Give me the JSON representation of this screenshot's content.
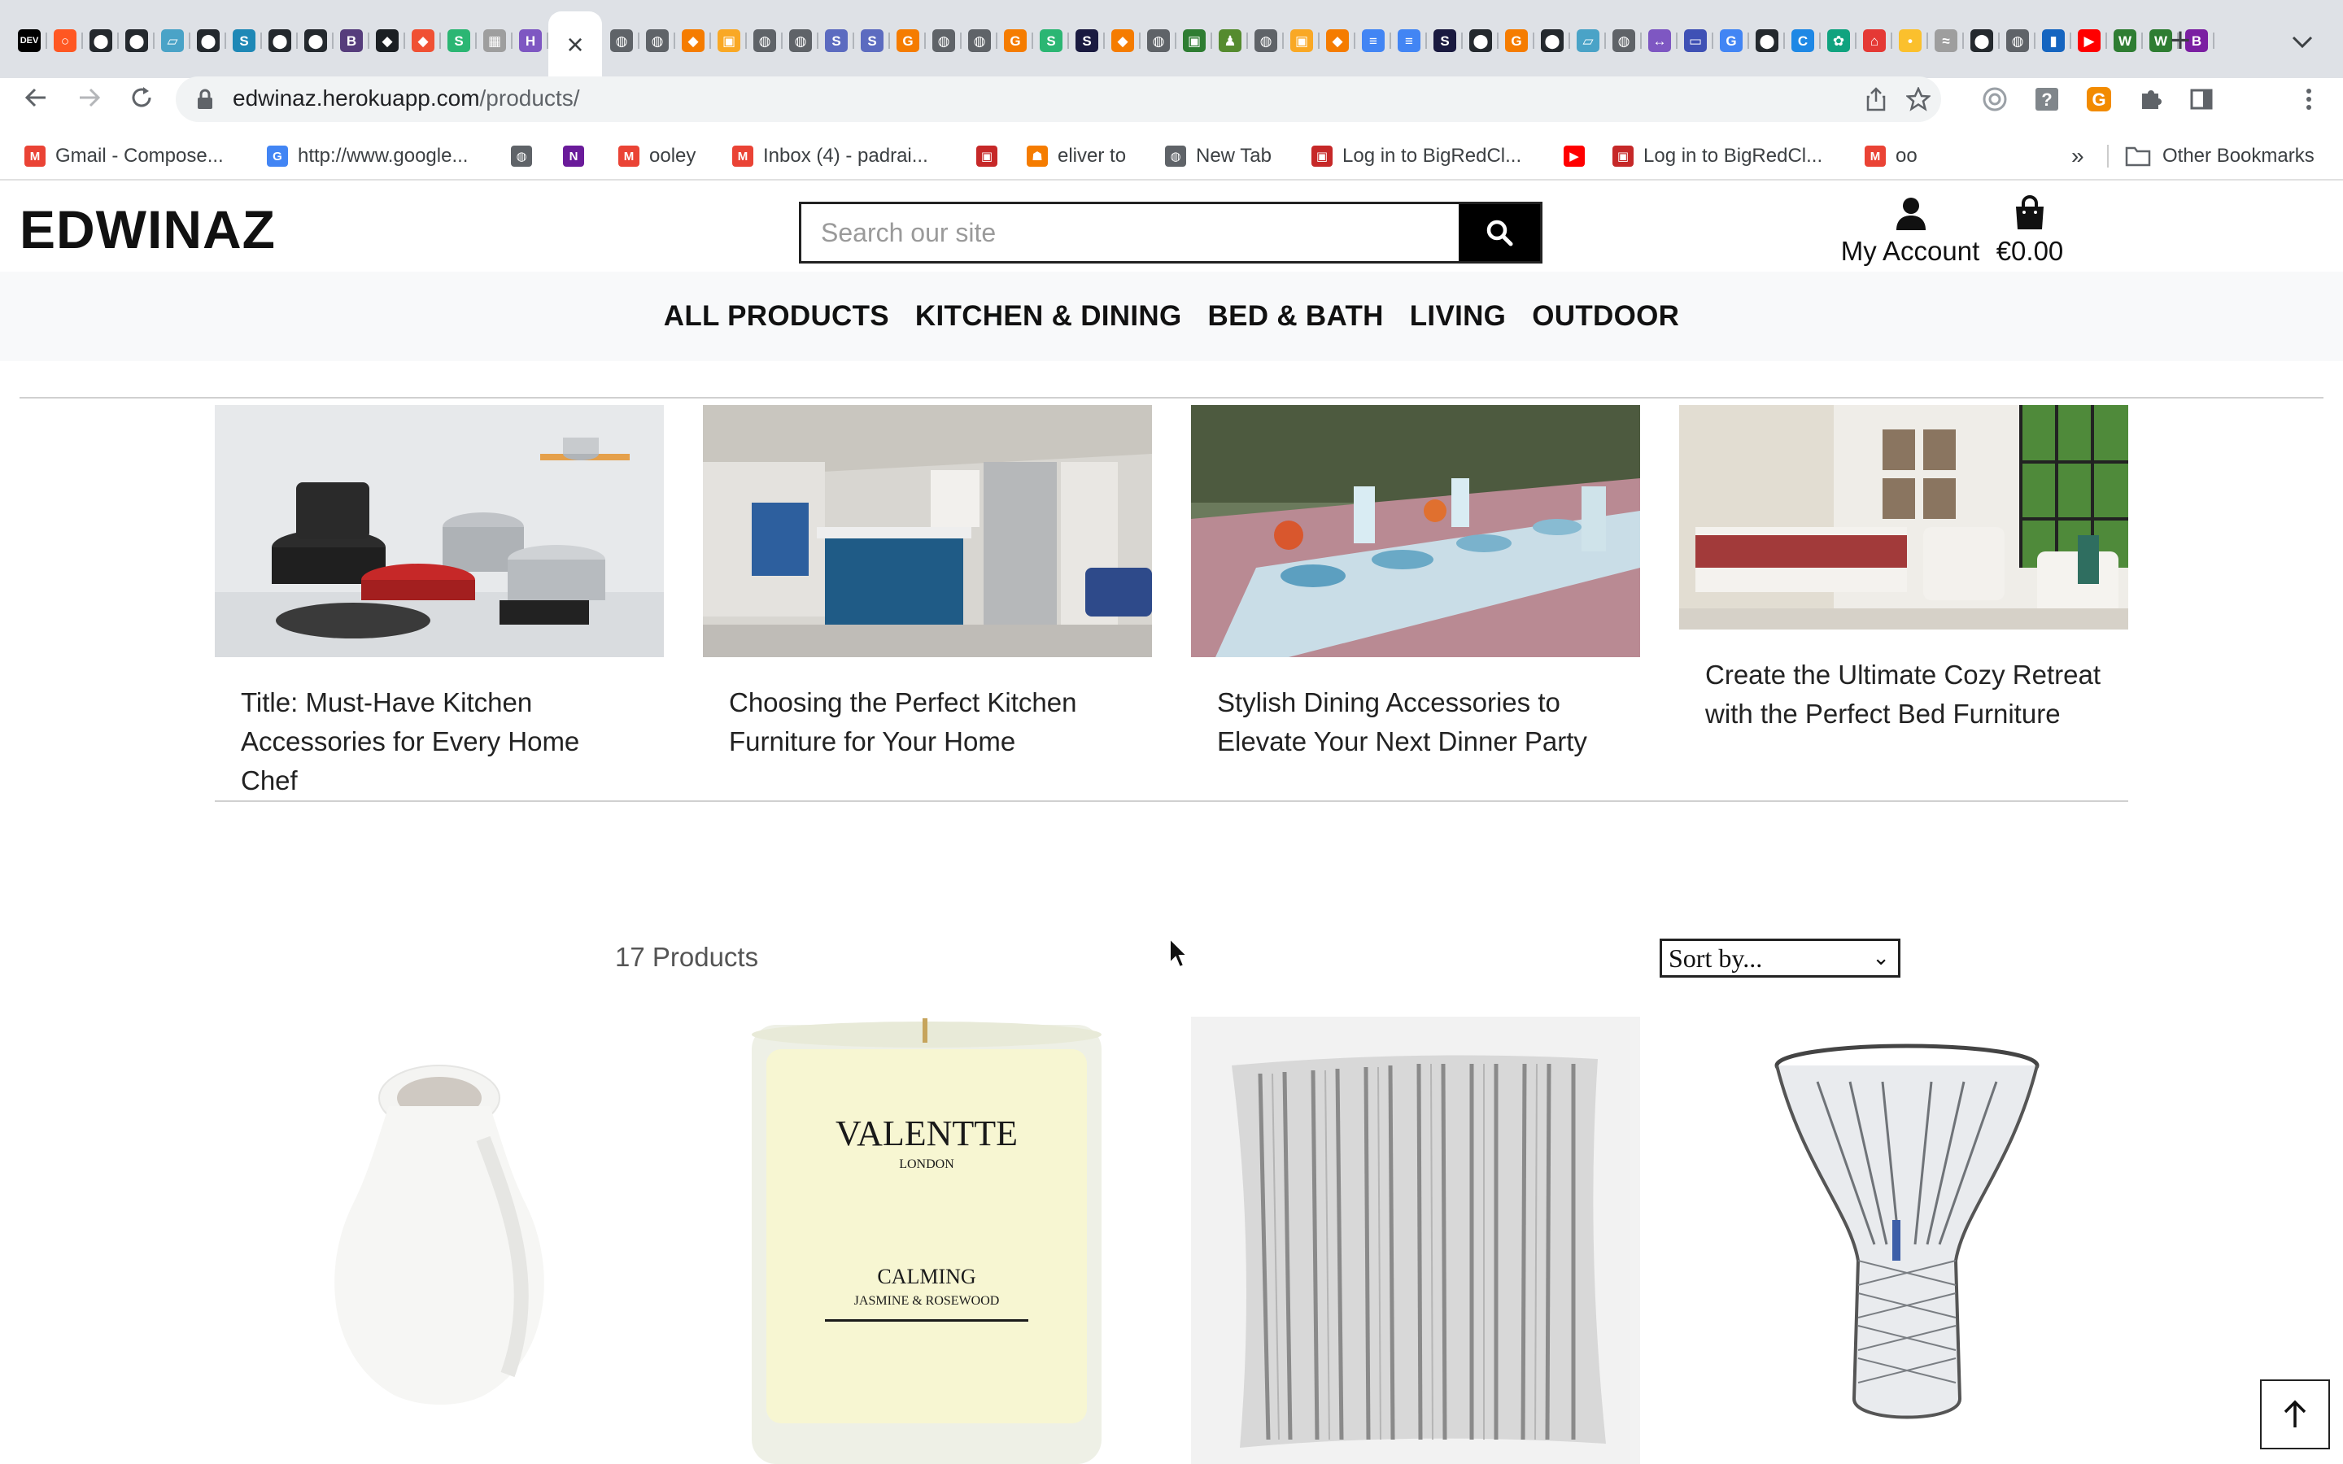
{
  "browser": {
    "active_tab_close_glyph": "×",
    "new_tab_glyph": "+",
    "tab_favicons": [
      {
        "label": "DEV",
        "color": "#000000",
        "icon": "dev-favicon"
      },
      {
        "label": "○",
        "color": "#ff5722",
        "icon": "circle-favicon"
      },
      {
        "label": "⬤",
        "color": "#24292e",
        "icon": "github-favicon"
      },
      {
        "label": "⬤",
        "color": "#24292e",
        "icon": "github-favicon"
      },
      {
        "label": "▱",
        "color": "#4aa3c7",
        "icon": "book-favicon"
      },
      {
        "label": "⬤",
        "color": "#24292e",
        "icon": "github-favicon"
      },
      {
        "label": "S",
        "color": "#1e88b6",
        "icon": "s-favicon"
      },
      {
        "label": "⬤",
        "color": "#24292e",
        "icon": "github-favicon"
      },
      {
        "label": "⬤",
        "color": "#24292e",
        "icon": "github-favicon"
      },
      {
        "label": "B",
        "color": "#563d7c",
        "icon": "bootstrap-favicon"
      },
      {
        "label": "◆",
        "color": "#1b1f23",
        "icon": "dark-favicon"
      },
      {
        "label": "◆",
        "color": "#f05033",
        "icon": "git-favicon"
      },
      {
        "label": "S",
        "color": "#2bb673",
        "icon": "s-green-favicon"
      },
      {
        "label": "▦",
        "color": "#9e9e9e",
        "icon": "grid-favicon"
      },
      {
        "label": "H",
        "color": "#7e57c2",
        "icon": "h-favicon"
      }
    ],
    "tab_favicons_right": [
      {
        "label": "◍",
        "color": "#5f6368"
      },
      {
        "label": "◍",
        "color": "#5f6368"
      },
      {
        "label": "◆",
        "color": "#f57c00"
      },
      {
        "label": "▣",
        "color": "#f9a825"
      },
      {
        "label": "◍",
        "color": "#5f6368"
      },
      {
        "label": "◍",
        "color": "#5f6368"
      },
      {
        "label": "S",
        "color": "#5c6bc0"
      },
      {
        "label": "S",
        "color": "#5c6bc0"
      },
      {
        "label": "G",
        "color": "#f57c00"
      },
      {
        "label": "◍",
        "color": "#5f6368"
      },
      {
        "label": "◍",
        "color": "#5f6368"
      },
      {
        "label": "G",
        "color": "#f57c00"
      },
      {
        "label": "S",
        "color": "#2bb673"
      },
      {
        "label": "S",
        "color": "#1a1a40"
      },
      {
        "label": "◆",
        "color": "#f57c00"
      },
      {
        "label": "◍",
        "color": "#5f6368"
      },
      {
        "label": "▣",
        "color": "#2e7d32"
      },
      {
        "label": "♟",
        "color": "#558b2f"
      },
      {
        "label": "◍",
        "color": "#5f6368"
      },
      {
        "label": "▣",
        "color": "#f9a825"
      },
      {
        "label": "◆",
        "color": "#f57c00"
      },
      {
        "label": "≡",
        "color": "#4285f4"
      },
      {
        "label": "≡",
        "color": "#4285f4"
      },
      {
        "label": "S",
        "color": "#1a1a40"
      },
      {
        "label": "⬤",
        "color": "#24292e"
      },
      {
        "label": "G",
        "color": "#f57c00"
      },
      {
        "label": "⬤",
        "color": "#24292e"
      },
      {
        "label": "▱",
        "color": "#4aa3c7"
      },
      {
        "label": "◍",
        "color": "#5f6368"
      },
      {
        "label": "↔",
        "color": "#7e57c2"
      },
      {
        "label": "▭",
        "color": "#3f51b5"
      },
      {
        "label": "G",
        "color": "#4285f4"
      },
      {
        "label": "⬤",
        "color": "#24292e"
      },
      {
        "label": "C",
        "color": "#1e88e5"
      },
      {
        "label": "✿",
        "color": "#10a37f"
      },
      {
        "label": "⌂",
        "color": "#e53935"
      },
      {
        "label": "•",
        "color": "#fbc02d"
      },
      {
        "label": "≈",
        "color": "#9e9e9e"
      },
      {
        "label": "⬤",
        "color": "#24292e"
      },
      {
        "label": "◍",
        "color": "#5f6368"
      },
      {
        "label": "▮",
        "color": "#1565c0"
      },
      {
        "label": "▶",
        "color": "#ff0000"
      },
      {
        "label": "W",
        "color": "#2e7d32"
      },
      {
        "label": "W",
        "color": "#2e7d32"
      },
      {
        "label": "B",
        "color": "#7b1fa2"
      }
    ],
    "url_host": "edwinaz.herokuapp.com",
    "url_path": "/products/",
    "bookmarks": [
      {
        "label": "Gmail - Compose...",
        "icon": "gmail-icon",
        "color": "#ea4335",
        "glyph": "M"
      },
      {
        "label": "http://www.google...",
        "icon": "google-icon",
        "color": "#4285f4",
        "glyph": "G"
      },
      {
        "label": "",
        "icon": "globe-icon",
        "color": "#5f6368",
        "glyph": "◍"
      },
      {
        "label": "",
        "icon": "nbc-icon",
        "color": "#6a1b9a",
        "glyph": "N"
      },
      {
        "label": "ooley",
        "icon": "gmail-icon",
        "color": "#ea4335",
        "glyph": "M"
      },
      {
        "label": "Inbox (4) - padrai...",
        "icon": "gmail-icon",
        "color": "#ea4335",
        "glyph": "M"
      },
      {
        "label": "",
        "icon": "bigred-icon",
        "color": "#c62828",
        "glyph": "▣"
      },
      {
        "label": "eliver to",
        "icon": "deliveroo-icon",
        "color": "#f57c00",
        "glyph": "☗"
      },
      {
        "label": "New Tab",
        "icon": "globe-icon",
        "color": "#5f6368",
        "glyph": "◍"
      },
      {
        "label": "Log in to BigRedCl...",
        "icon": "bigred-icon",
        "color": "#c62828",
        "glyph": "▣"
      },
      {
        "label": "",
        "icon": "youtube-icon",
        "color": "#ff0000",
        "glyph": "▶"
      },
      {
        "label": "Log in to BigRedCl...",
        "icon": "bigred-icon",
        "color": "#c62828",
        "glyph": "▣"
      },
      {
        "label": "oo",
        "icon": "gmail-icon",
        "color": "#ea4335",
        "glyph": "M"
      }
    ],
    "bookmarks_overflow": "»",
    "other_bookmarks": "Other Bookmarks"
  },
  "site": {
    "logo": "EDWINAZ",
    "search_placeholder": "Search our site",
    "account_label": "My Account",
    "basket_total": "€0.00",
    "nav": [
      "ALL PRODUCTS",
      "KITCHEN & DINING",
      "BED & BATH",
      "LIVING",
      "OUTDOOR"
    ],
    "posts": [
      {
        "title": "Title: Must-Have Kitchen Accessories for Every Home Chef",
        "image": "cookware-set-photo"
      },
      {
        "title": "Choosing the Perfect Kitchen Furniture for Your Home",
        "image": "kitchen-island-photo"
      },
      {
        "title": "Stylish Dining Accessories to Elevate Your Next Dinner Party",
        "image": "dining-table-photo"
      },
      {
        "title": "Create the Ultimate Cozy Retreat with the Perfect Bed Furniture",
        "image": "bedroom-photo"
      }
    ],
    "product_count": "17 Products",
    "sort_label": "Sort by...",
    "products": [
      {
        "image": "white-vase-photo"
      },
      {
        "image": "candle-photo",
        "brand": "VALENTTE",
        "city": "LONDON",
        "scent": "CALMING",
        "notes": "JASMINE & ROSEWOOD"
      },
      {
        "image": "striped-cushion-photo"
      },
      {
        "image": "crystal-vase-photo"
      }
    ]
  }
}
